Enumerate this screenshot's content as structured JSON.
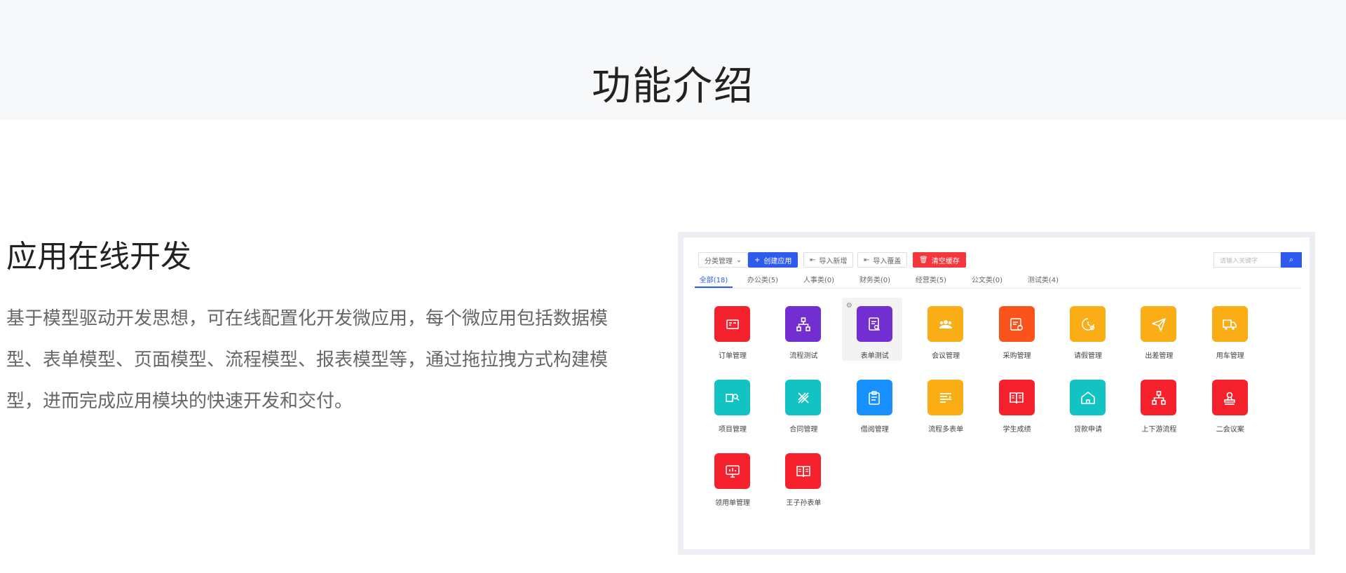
{
  "hero": {
    "title": "功能介绍"
  },
  "feature": {
    "title": "应用在线开发",
    "description": "基于模型驱动开发思想，可在线配置化开发微应用，每个微应用包括数据模型、表单模型、页面模型、流程模型、报表模型等，通过拖拉拽方式构建模型，进而完成应用模块的快速开发和交付。"
  },
  "toolbar": {
    "category_label": "分类管理",
    "create_label": "创建应用",
    "import_new_label": "导入新增",
    "import_overwrite_label": "导入覆盖",
    "clear_cache_label": "清空缓存",
    "search_placeholder": "请输入关键字"
  },
  "tabs": [
    {
      "label": "全部(18)",
      "active": true
    },
    {
      "label": "办公类(5)"
    },
    {
      "label": "人事类(0)"
    },
    {
      "label": "财务类(0)"
    },
    {
      "label": "经营类(5)"
    },
    {
      "label": "公文类(0)"
    },
    {
      "label": "测试类(4)"
    }
  ],
  "apps": [
    {
      "label": "订单管理",
      "color": "#f5222d",
      "icon": "order-icon"
    },
    {
      "label": "流程测试",
      "color": "#722ed1",
      "icon": "flow-icon"
    },
    {
      "label": "表单测试",
      "color": "#722ed1",
      "icon": "form-icon",
      "hovered": true
    },
    {
      "label": "会议管理",
      "color": "#faad14",
      "icon": "meeting-icon"
    },
    {
      "label": "采购管理",
      "color": "#fa541c",
      "icon": "purchase-icon"
    },
    {
      "label": "请假管理",
      "color": "#faad14",
      "icon": "leave-icon"
    },
    {
      "label": "出差管理",
      "color": "#faad14",
      "icon": "travel-icon"
    },
    {
      "label": "用车管理",
      "color": "#faad14",
      "icon": "truck-icon"
    },
    {
      "label": "项目管理",
      "color": "#13c2c2",
      "icon": "project-icon"
    },
    {
      "label": "合同管理",
      "color": "#13c2c2",
      "icon": "contract-icon"
    },
    {
      "label": "借阅管理",
      "color": "#1890ff",
      "icon": "clipboard-icon"
    },
    {
      "label": "流程多表单",
      "color": "#faad14",
      "icon": "list-icon"
    },
    {
      "label": "学生成绩",
      "color": "#f5222d",
      "icon": "book-icon"
    },
    {
      "label": "贷款申请",
      "color": "#13c2c2",
      "icon": "home-icon"
    },
    {
      "label": "上下游流程",
      "color": "#f5222d",
      "icon": "flow-icon"
    },
    {
      "label": "二会议案",
      "color": "#f5222d",
      "icon": "stamp-icon"
    },
    {
      "label": "领用单管理",
      "color": "#f5222d",
      "icon": "monitor-icon"
    },
    {
      "label": "王子孙表单",
      "color": "#f5222d",
      "icon": "book-icon"
    }
  ]
}
